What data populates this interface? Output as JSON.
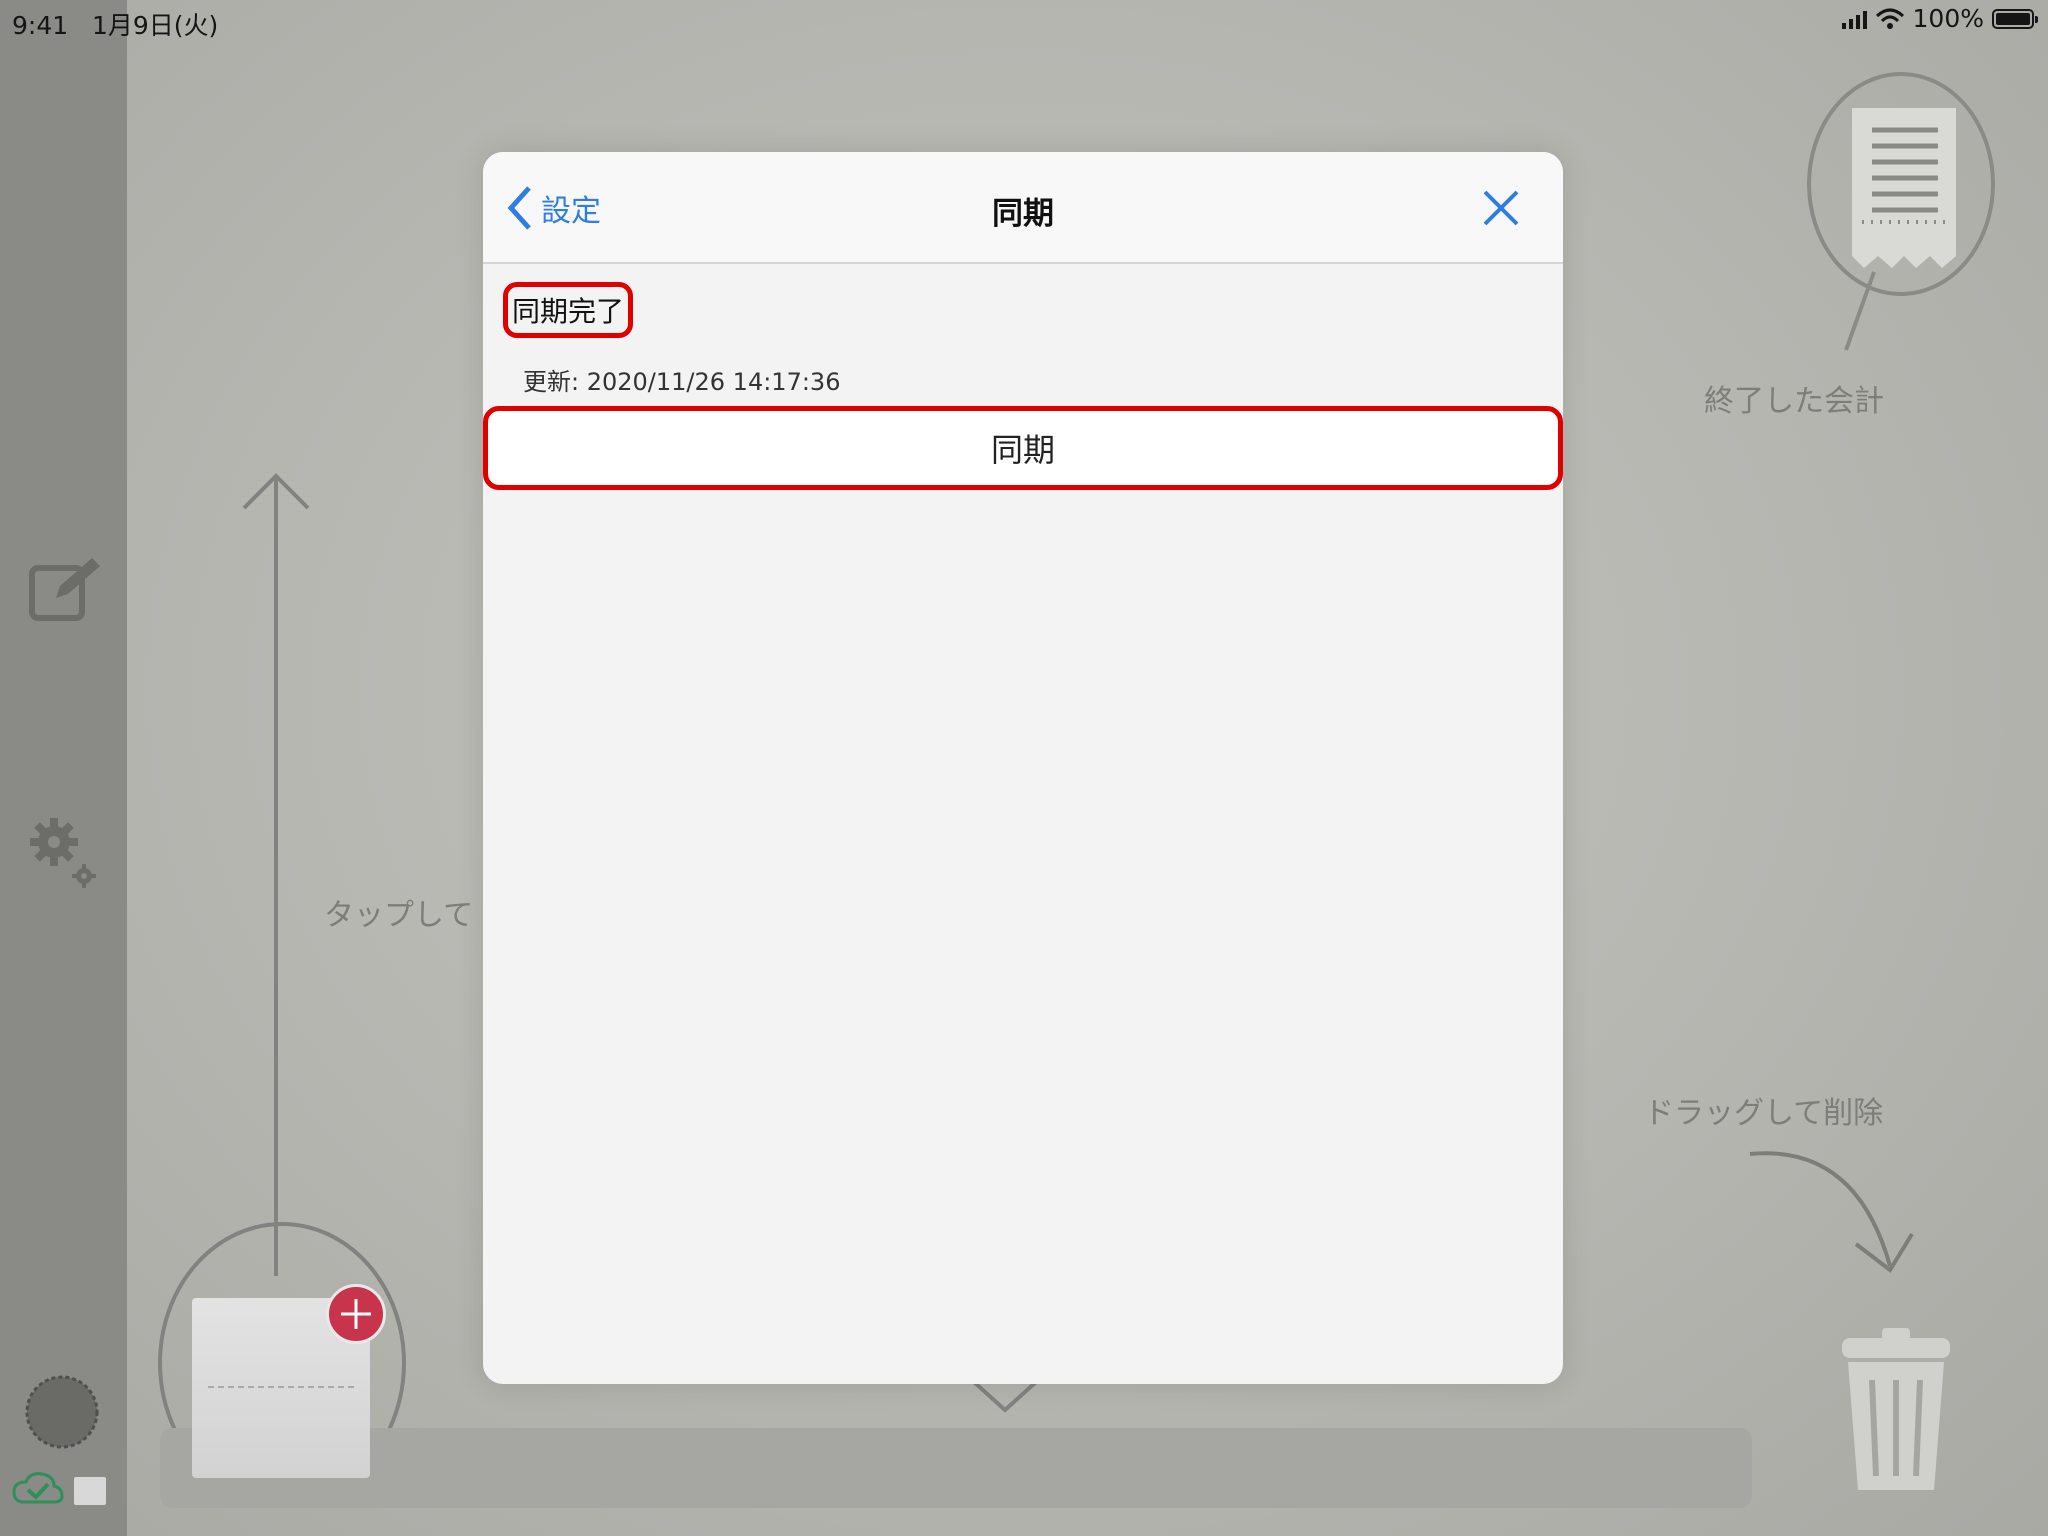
{
  "status_bar": {
    "time": "9:41",
    "date": "1月9日(火)",
    "battery": "100%"
  },
  "background": {
    "tap_hint": "タップして",
    "finished_label": "終了した会計",
    "drag_delete_label": "ドラッグして削除"
  },
  "modal": {
    "back_label": "設定",
    "title": "同期",
    "status": "同期完了",
    "updated": "更新: 2020/11/26 14:17:36",
    "sync_button_label": "同期"
  },
  "colors": {
    "accent": "#2f7de1",
    "highlight": "#e00000",
    "add_badge": "#c8344b"
  }
}
